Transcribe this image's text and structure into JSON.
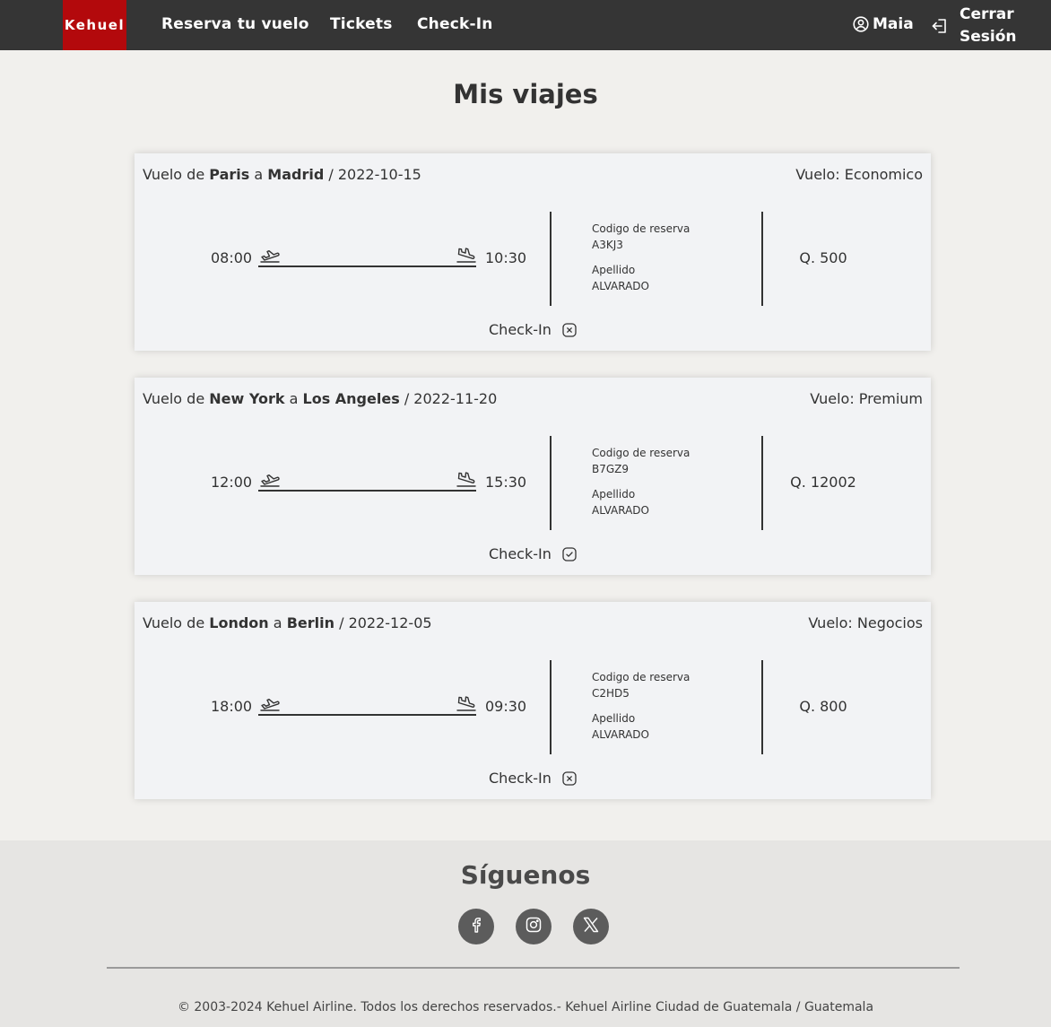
{
  "nav": {
    "logo": "Kehuel",
    "links": [
      "Reserva tu vuelo",
      "Tickets",
      "Check-In"
    ],
    "user": "Maia",
    "logout": "Cerrar Sesión"
  },
  "page": {
    "title": "Mis viajes"
  },
  "labels": {
    "route_prefix": "Vuelo de",
    "route_connector": "a",
    "date_separator": "/",
    "class_prefix": "Vuelo:",
    "codigo_label": "Codigo de reserva",
    "apellido_label": "Apellido",
    "checkin_label": "Check-In"
  },
  "trips": [
    {
      "origin": "Paris",
      "destination": "Madrid",
      "date": "2022-10-15",
      "class": "Economico",
      "departure": "08:00",
      "arrival": "10:30",
      "codigo": "A3KJ3",
      "apellido": "ALVARADO",
      "price": "Q. 500",
      "checkin_status": "pending",
      "checkin_icon": "close-square-icon"
    },
    {
      "origin": "New York",
      "destination": "Los Angeles",
      "date": "2022-11-20",
      "class": "Premium",
      "departure": "12:00",
      "arrival": "15:30",
      "codigo": "B7GZ9",
      "apellido": "ALVARADO",
      "price": "Q. 12002",
      "checkin_status": "done",
      "checkin_icon": "check-square-icon"
    },
    {
      "origin": "London",
      "destination": "Berlin",
      "date": "2022-12-05",
      "class": "Negocios",
      "departure": "18:00",
      "arrival": "09:30",
      "codigo": "C2HD5",
      "apellido": "ALVARADO",
      "price": "Q. 800",
      "checkin_status": "pending",
      "checkin_icon": "close-square-icon"
    }
  ],
  "footer": {
    "title": "Síguenos",
    "social": [
      "facebook-icon",
      "instagram-icon",
      "x-icon"
    ],
    "copyright": "© 2003-2024 Kehuel Airline. Todos los derechos reservados.- Kehuel Airline Ciudad de Guatemala / Guatemala"
  },
  "colors": {
    "navbar": "#353535",
    "logo_bg": "#b3090c",
    "page_bg": "#f1f0ed",
    "card_bg": "#f2f3f5",
    "footer_bg": "#e6e5e3",
    "social_bg": "#5c5c5c"
  }
}
